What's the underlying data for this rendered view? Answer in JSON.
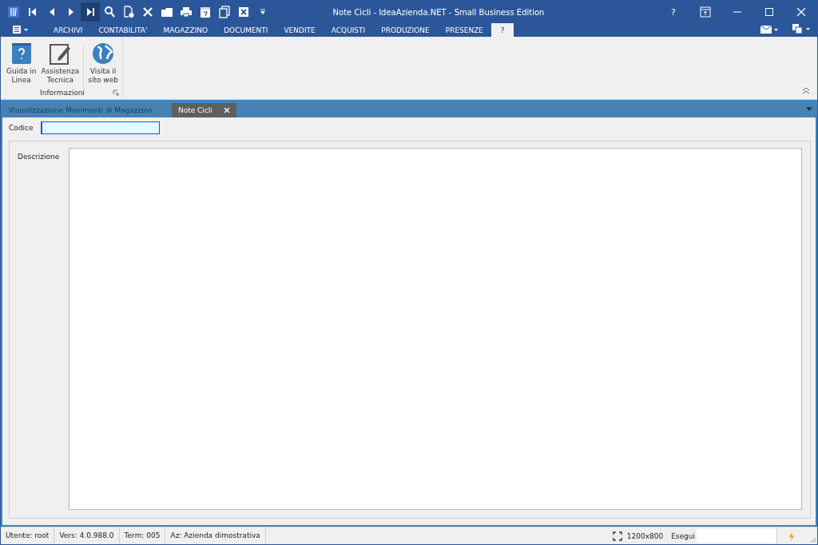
{
  "window": {
    "title": "Note Cicli - IdeaAzienda.NET - Small Business Edition",
    "help": "?"
  },
  "quick_access": [
    {
      "kind": "logo",
      "selected": false
    },
    {
      "kind": "first",
      "selected": false
    },
    {
      "kind": "prev",
      "selected": false
    },
    {
      "kind": "next",
      "selected": false
    },
    {
      "kind": "last",
      "selected": true
    },
    {
      "kind": "search",
      "selected": false
    },
    {
      "kind": "new",
      "selected": false
    },
    {
      "kind": "delete",
      "selected": false
    },
    {
      "kind": "folder",
      "selected": false
    },
    {
      "kind": "print",
      "selected": false
    },
    {
      "kind": "calendar",
      "selected": false
    },
    {
      "kind": "copy",
      "selected": false
    },
    {
      "kind": "excel",
      "selected": false
    },
    {
      "kind": "more",
      "selected": false
    }
  ],
  "ribbon_tabs": [
    {
      "label": "ARCHIVI",
      "selected": false
    },
    {
      "label": "CONTABILITA'",
      "selected": false
    },
    {
      "label": "MAGAZZINO",
      "selected": false
    },
    {
      "label": "DOCUMENTI",
      "selected": false
    },
    {
      "label": "VENDITE",
      "selected": false
    },
    {
      "label": "ACQUISTI",
      "selected": false
    },
    {
      "label": "PRODUZIONE",
      "selected": false
    },
    {
      "label": "PRESENZE",
      "selected": false
    },
    {
      "label": "?",
      "selected": true
    }
  ],
  "ribbon_group": {
    "label": "Informazioni",
    "buttons": [
      {
        "kind": "help",
        "label": "Guida in\nLinea"
      },
      {
        "kind": "edit",
        "label": "Assistenza\nTecnica"
      },
      {
        "kind": "globe",
        "label": "Visita il\nsito web"
      }
    ]
  },
  "document_tabs": [
    {
      "label": "Visualizzazione Movimenti di Magazzino",
      "selected": false,
      "closable": false
    },
    {
      "label": "Note Cicli",
      "selected": true,
      "closable": true
    }
  ],
  "form": {
    "fields": [
      {
        "label": "Codice",
        "kind": "line",
        "focused": true
      },
      {
        "label": "Descrizione",
        "kind": "memo",
        "focused": false
      }
    ]
  },
  "status_bar": {
    "items": [
      "Utente: root",
      "Vers: 4.0.988.0",
      "Term: 005",
      "Az: Azienda dimostrativa"
    ],
    "resolution": "1200x800",
    "run_label": "Esegui"
  }
}
